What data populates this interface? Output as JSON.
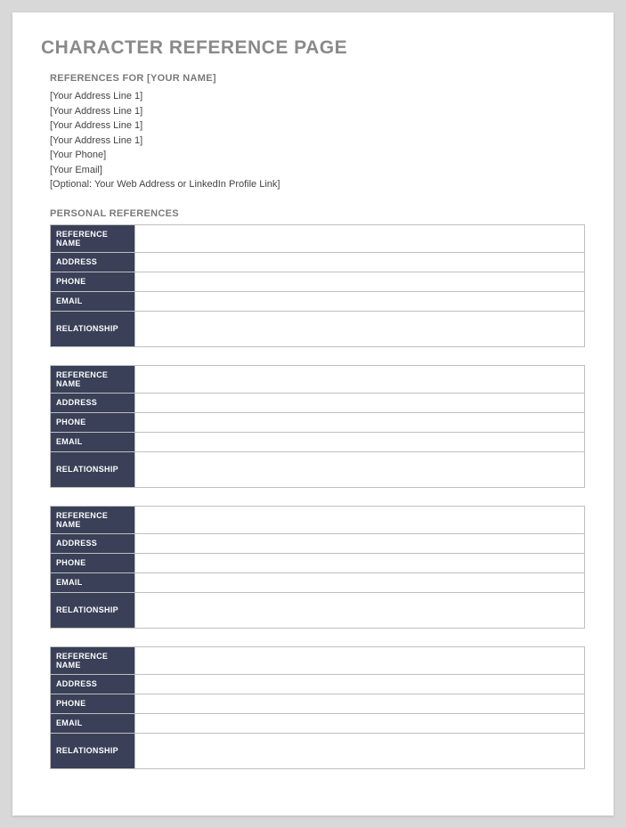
{
  "page_title": "CHARACTER REFERENCE PAGE",
  "references_for_heading": "REFERENCES FOR [YOUR NAME]",
  "contact_info": [
    "[Your Address Line 1]",
    "[Your Address Line 1]",
    "[Your Address Line 1]",
    "[Your Address Line 1]",
    "[Your Phone]",
    "[Your Email]",
    "[Optional: Your Web Address or LinkedIn Profile Link]"
  ],
  "personal_references_heading": "PERSONAL REFERENCES",
  "reference_fields": {
    "name": "REFERENCE NAME",
    "address": "ADDRESS",
    "phone": "PHONE",
    "email": "EMAIL",
    "relationship": "RELATIONSHIP"
  },
  "references": [
    {
      "name": "",
      "address": "",
      "phone": "",
      "email": "",
      "relationship": ""
    },
    {
      "name": "",
      "address": "",
      "phone": "",
      "email": "",
      "relationship": ""
    },
    {
      "name": "",
      "address": "",
      "phone": "",
      "email": "",
      "relationship": ""
    },
    {
      "name": "",
      "address": "",
      "phone": "",
      "email": "",
      "relationship": ""
    }
  ]
}
